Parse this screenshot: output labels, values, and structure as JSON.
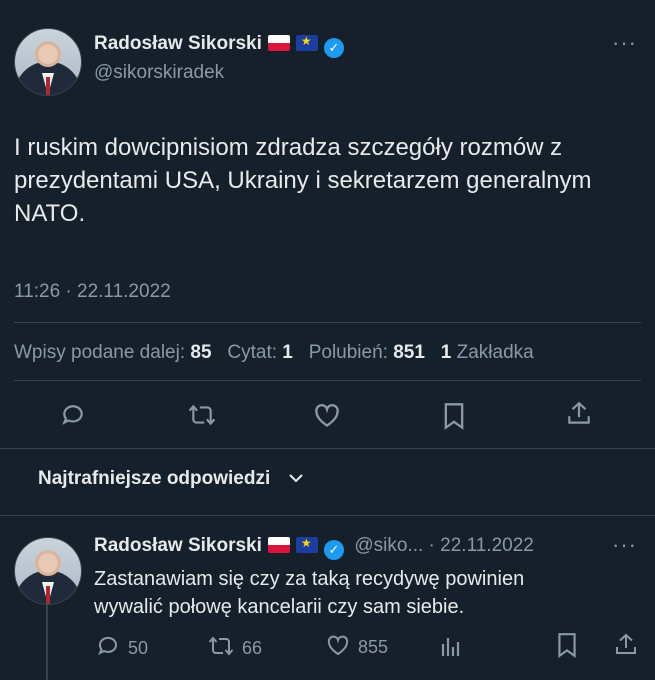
{
  "main_tweet": {
    "author_name": "Radosław Sikorski",
    "handle": "@sikorskiradek",
    "text": "I ruskim dowcipnisiom zdradza szczegóły rozmów z prezydentami USA, Ukrainy i sekretarzem generalnym NATO.",
    "time": "11:26 · 22.11.2022",
    "stats": {
      "reposts_label": "Wpisy podane dalej:",
      "reposts": "85",
      "quotes_label": "Cytat:",
      "quotes": "1",
      "likes_label": "Polubień:",
      "likes": "851",
      "bookmarks": "1",
      "bookmarks_label": "Zakładka"
    },
    "more": "···"
  },
  "replies_sort": {
    "label": "Najtrafniejsze odpowiedzi"
  },
  "reply": {
    "author_name": "Radosław Sikorski",
    "handle_date": "@siko... · 22.11.2022",
    "text_line1": "Zastanawiam się czy za taką recydywę powinien",
    "text_line2": "wywalić połowę kancelarii czy sam siebie.",
    "replies": "50",
    "reposts": "66",
    "likes": "855",
    "more": "···"
  },
  "colors": {
    "background": "#15202b",
    "text": "#e7e9ea",
    "muted": "#8b98a5",
    "divider": "#38444d",
    "verified": "#1d9bf0"
  }
}
